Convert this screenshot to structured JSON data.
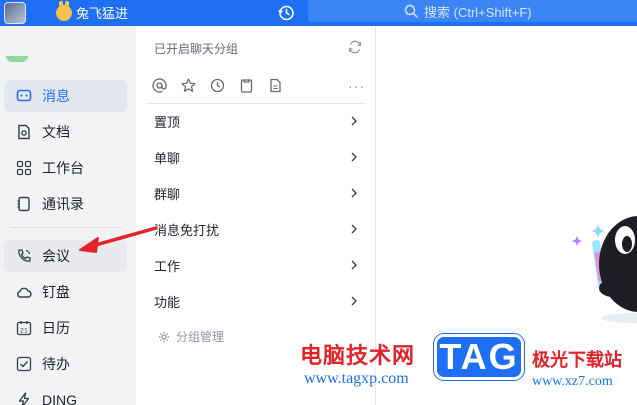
{
  "topbar": {
    "user_name": "兔飞猛进",
    "search_placeholder": "搜索 (Ctrl+Shift+F)"
  },
  "nav": {
    "items": [
      {
        "label": "消息",
        "icon": "message-icon",
        "active": true
      },
      {
        "label": "文档",
        "icon": "document-icon",
        "active": false
      },
      {
        "label": "工作台",
        "icon": "workbench-icon",
        "active": false
      },
      {
        "label": "通讯录",
        "icon": "contacts-icon",
        "active": false
      },
      {
        "label": "会议",
        "icon": "meeting-phone-icon",
        "active": false
      },
      {
        "label": "钉盘",
        "icon": "cloud-disk-icon",
        "active": false
      },
      {
        "label": "日历",
        "icon": "calendar-icon",
        "active": false
      },
      {
        "label": "待办",
        "icon": "todo-icon",
        "active": false
      },
      {
        "label": "DING",
        "icon": "ding-icon",
        "active": false
      }
    ]
  },
  "mid": {
    "header": "已开启聊天分组",
    "toolbar_icons": [
      "at-icon",
      "star-icon",
      "clock-icon",
      "clipboard-icon",
      "file-icon"
    ],
    "menu": [
      {
        "label": "置顶"
      },
      {
        "label": "单聊"
      },
      {
        "label": "群聊"
      },
      {
        "label": "消息免打扰"
      },
      {
        "label": "工作"
      },
      {
        "label": "功能"
      }
    ],
    "group_manage": "分组管理"
  },
  "watermark": {
    "title": "电脑技术网",
    "url": "www.tagxp.com",
    "tag": "TAG",
    "site": "极光下载站",
    "url2": "www.xz7.com"
  },
  "colors": {
    "brand_blue": "#1e6ff4",
    "arrow_red": "#e2232a"
  }
}
